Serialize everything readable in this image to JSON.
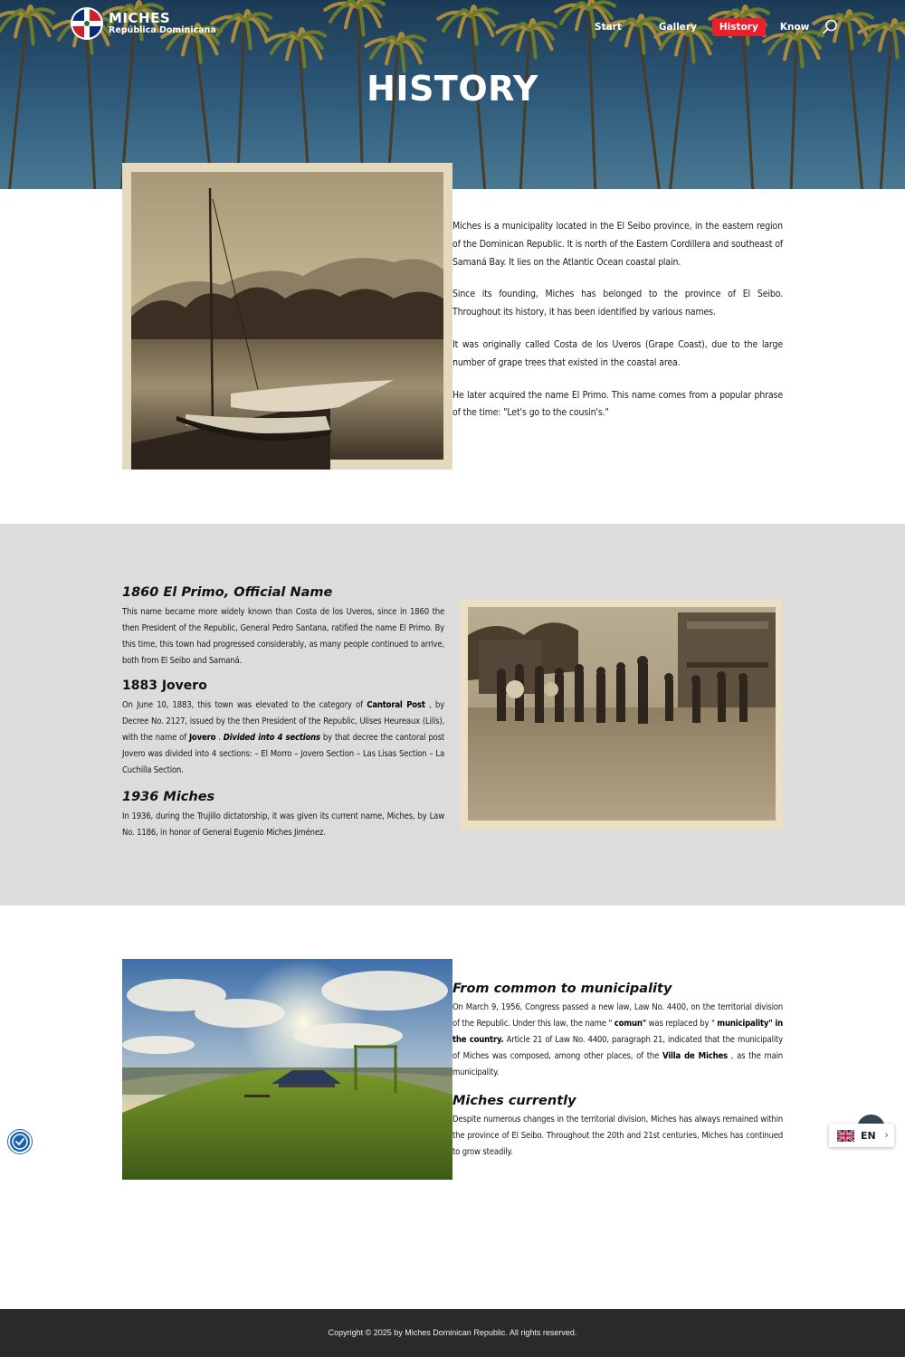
{
  "header": {
    "logo_title": "MICHES",
    "logo_subtitle": "República Dominicana",
    "nav": [
      {
        "label": "Start"
      },
      {
        "label": "Gallery"
      },
      {
        "label": "History",
        "active": true
      },
      {
        "label": "Know"
      }
    ],
    "accent_color": "#e8202e"
  },
  "hero": {
    "title": "HISTORY"
  },
  "intro": {
    "paragraphs": [
      "Miches is a municipality located in the El Seibo province, in the eastern region of the Dominican Republic. It is north of the Eastern Cordillera and southeast of Samaná Bay. It lies on the Atlantic Ocean coastal plain.",
      "Since its founding, Miches has belonged to the province of El Seibo. Throughout its history, it has been identified by various names.",
      "It was originally called Costa de los Uveros (Grape Coast), due to the large number of grape trees that existed in the coastal area.",
      "He later acquired the name El Primo. This name comes from a popular phrase of the time: \"Let's go to the cousin's.\""
    ]
  },
  "timeline": {
    "h1860": "1860 El Primo, Official Name",
    "p1860": "This name became more widely known than Costa de los Uveros, since in 1860 the then President of the Republic, General Pedro Santana, ratified the name El Primo. By this time, this town had progressed considerably, as many people continued to arrive, both from El Seibo and Samaná.",
    "h1883": "1883 Jovero",
    "p1883_a": "On June 10, 1883, this town was elevated to the category of ",
    "p1883_b": "Cantoral Post",
    "p1883_c": " , by Decree No. 2127, issued by the then President of the Republic, Ulises Heureaux (Lilís), with the name of ",
    "p1883_d": "Jovero",
    "p1883_e": " . ",
    "p1883_f": "Divided into 4 sections",
    "p1883_g": " by that decree the cantoral post Jovero was divided into 4 sections: – El Morro – Jovero Section – Las Lisas Section – La Cuchilla Section.",
    "h1936": "1936 Miches",
    "p1936": "In 1936, during the Trujillo dictatorship, it was given its current name, Miches, by Law No. 1186, in honor of General Eugenio Miches Jiménez."
  },
  "municipality": {
    "h_common": "From common to municipality",
    "p_a": "On March 9, 1956, Congress passed a new law, Law No. 4400, on the territorial division of the Republic. Under this law, the name \" ",
    "p_b": "comun\"",
    "p_c": " was replaced  by \" ",
    "p_d": "municipality\" in the country.",
    "p_e": "  Article 21 of Law No. 4400, paragraph 21, indicated that the municipality of Miches was composed, among other places, of the ",
    "p_f": "Villa de Miches",
    "p_g": " , as the main municipality.",
    "h_current": "Miches currently",
    "p_current": "Despite numerous changes in the territorial division, Miches has always remained within the province of El Seibo. Throughout the 20th and 21st centuries, Miches has continued to grow steadily."
  },
  "language": {
    "code": "EN"
  },
  "footer": {
    "copyright": "Copyright © 2025 by Miches Dominican Republic. All rights reserved."
  }
}
